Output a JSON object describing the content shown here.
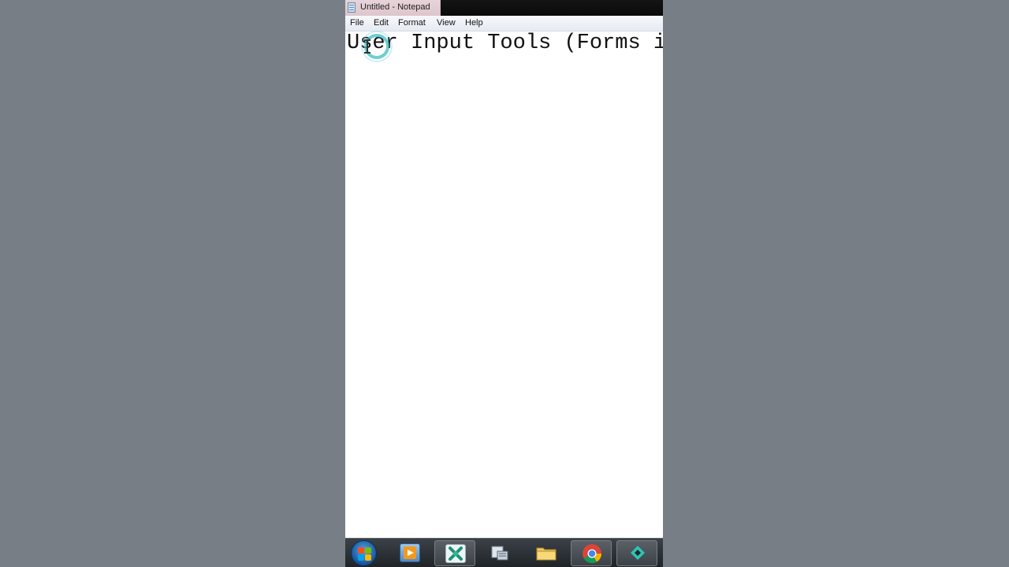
{
  "window": {
    "title": "Untitled - Notepad"
  },
  "menu": {
    "items": [
      {
        "label": "File"
      },
      {
        "label": "Edit"
      },
      {
        "label": "Format"
      },
      {
        "label": "View"
      },
      {
        "label": "Help"
      }
    ]
  },
  "editor": {
    "text": "User Input Tools (Forms in"
  },
  "taskbar": {
    "items": [
      {
        "name": "start-button",
        "icon": "windows-logo-icon"
      },
      {
        "name": "media-player",
        "icon": "media-player-icon"
      },
      {
        "name": "app-x",
        "icon": "app-x-icon"
      },
      {
        "name": "notepad-program",
        "icon": "notepad-program-icon"
      },
      {
        "name": "file-explorer",
        "icon": "folder-icon"
      },
      {
        "name": "chrome",
        "icon": "chrome-icon"
      },
      {
        "name": "video-editor",
        "icon": "video-editor-icon"
      }
    ]
  },
  "colors": {
    "background": "#787e85",
    "click_ring": "#3ebec4",
    "taskbar": "#2a2f34"
  }
}
